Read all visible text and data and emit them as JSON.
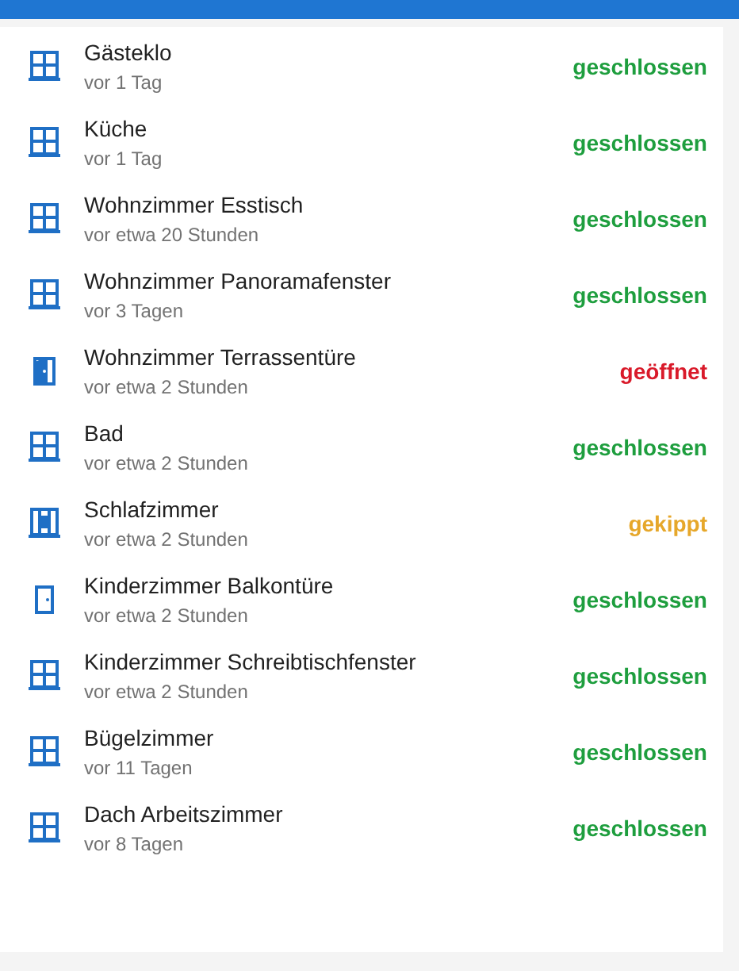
{
  "rows": [
    {
      "name": "Gästeklo",
      "time": "vor 1 Tag",
      "kind": "window",
      "status_text": "geschlossen",
      "color": "#1e9e3e"
    },
    {
      "name": "Küche",
      "time": "vor 1 Tag",
      "kind": "window",
      "status_text": "geschlossen",
      "color": "#1e9e3e"
    },
    {
      "name": "Wohnzimmer Esstisch",
      "time": "vor etwa 20 Stunden",
      "kind": "window",
      "status_text": "geschlossen",
      "color": "#1e9e3e"
    },
    {
      "name": "Wohnzimmer Panoramafenster",
      "time": "vor 3 Tagen",
      "kind": "window",
      "status_text": "geschlossen",
      "color": "#1e9e3e"
    },
    {
      "name": "Wohnzimmer Terrassentüre",
      "time": "vor etwa 2 Stunden",
      "kind": "door_open",
      "status_text": "geöffnet",
      "color": "#d91a2a"
    },
    {
      "name": "Bad",
      "time": "vor etwa 2 Stunden",
      "kind": "window",
      "status_text": "geschlossen",
      "color": "#1e9e3e"
    },
    {
      "name": "Schlafzimmer",
      "time": "vor etwa 2 Stunden",
      "kind": "window_tilted",
      "status_text": "gekippt",
      "color": "#e6a72a"
    },
    {
      "name": "Kinderzimmer Balkontüre",
      "time": "vor etwa 2 Stunden",
      "kind": "door",
      "status_text": "geschlossen",
      "color": "#1e9e3e"
    },
    {
      "name": "Kinderzimmer Schreibtischfenster",
      "time": "vor etwa 2 Stunden",
      "kind": "window",
      "status_text": "geschlossen",
      "color": "#1e9e3e"
    },
    {
      "name": "Bügelzimmer",
      "time": "vor 11 Tagen",
      "kind": "window",
      "status_text": "geschlossen",
      "color": "#1e9e3e"
    },
    {
      "name": "Dach Arbeitszimmer",
      "time": "vor 8 Tagen",
      "kind": "window",
      "status_text": "geschlossen",
      "color": "#1e9e3e"
    }
  ]
}
